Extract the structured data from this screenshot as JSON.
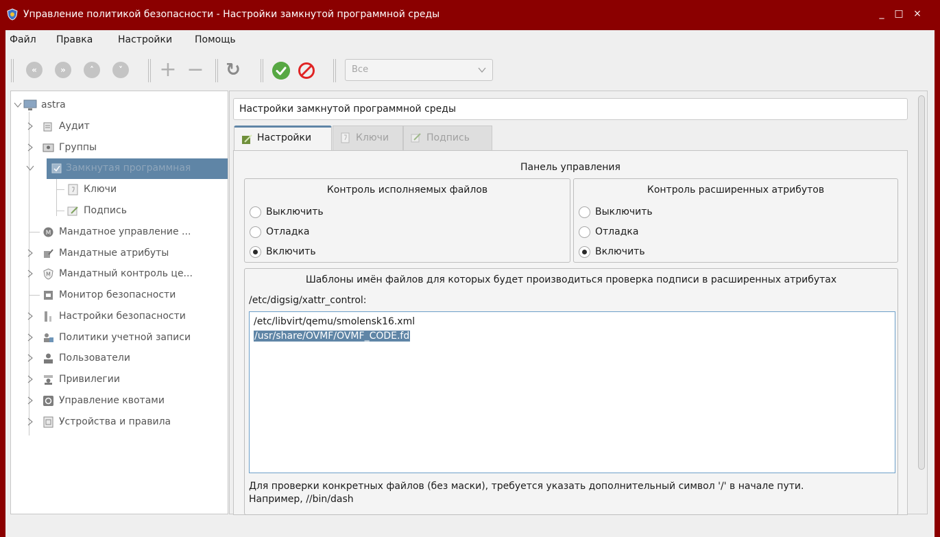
{
  "window": {
    "title": "Управление политикой безопасности - Настройки замкнутой программной среды",
    "minimize": "_",
    "maximize": "□",
    "close": "×"
  },
  "menu": [
    "Файл",
    "Правка",
    "Настройки",
    "Помощь"
  ],
  "toolbar": {
    "first_icon": "«",
    "last_icon": "»",
    "up_icon": "˄",
    "down_icon": "˅",
    "add_icon": "+",
    "remove_icon": "−",
    "refresh_icon": "↻",
    "filter_value": "Все"
  },
  "tree": {
    "root": "astra",
    "items": [
      {
        "label": "Аудит",
        "icon": "audit-icon"
      },
      {
        "label": "Группы",
        "icon": "groups-icon"
      },
      {
        "label": "Замкнутая программная",
        "icon": "closed-env-icon"
      },
      {
        "label": "Ключи",
        "icon": "key-icon"
      },
      {
        "label": "Подпись",
        "icon": "signature-icon"
      },
      {
        "label": "Мандатное управление ...",
        "icon": "mandatory-control-icon"
      },
      {
        "label": "Мандатные атрибуты",
        "icon": "mandatory-attributes-icon"
      },
      {
        "label": "Мандатный контроль це...",
        "icon": "integrity-control-icon"
      },
      {
        "label": "Монитор безопасности",
        "icon": "monitor-icon"
      },
      {
        "label": "Настройки безопасности",
        "icon": "security-settings-icon"
      },
      {
        "label": "Политики учетной записи",
        "icon": "account-policy-icon"
      },
      {
        "label": "Пользователи",
        "icon": "users-icon"
      },
      {
        "label": "Привилегии",
        "icon": "privileges-icon"
      },
      {
        "label": "Управление квотами",
        "icon": "quotas-icon"
      },
      {
        "label": "Устройства и правила",
        "icon": "devices-icon"
      }
    ]
  },
  "main": {
    "heading": "Настройки замкнутой программной среды",
    "tabs": [
      {
        "label": "Настройки",
        "active": true
      },
      {
        "label": "Ключи",
        "active": false
      },
      {
        "label": "Подпись",
        "active": false
      }
    ],
    "panel_title": "Панель управления",
    "exec_control": {
      "title": "Контроль исполняемых файлов",
      "options": [
        "Выключить",
        "Отладка",
        "Включить"
      ],
      "selected": "Включить"
    },
    "xattr_control": {
      "title": "Контроль расширенных атрибутов",
      "options": [
        "Выключить",
        "Отладка",
        "Включить"
      ],
      "selected": "Включить"
    },
    "templates": {
      "title": "Шаблоны имён файлов для которых будет производиться проверка подписи в расширенных атрибутах",
      "path_label": "/etc/digsig/xattr_control:",
      "lines": [
        "/etc/libvirt/qemu/smolensk16.xml",
        "/usr/share/OVMF/OVMF_CODE.fd"
      ],
      "note_line1": "Для проверки конкретных файлов (без маски), требуется указать дополнительный символ '/' в начале пути.",
      "note_line2": "Например, //bin/dash"
    }
  },
  "colors": {
    "titlebar": "#8b0000",
    "selection": "#5f85a6",
    "ok": "#57a843",
    "cancel": "#e02424"
  }
}
